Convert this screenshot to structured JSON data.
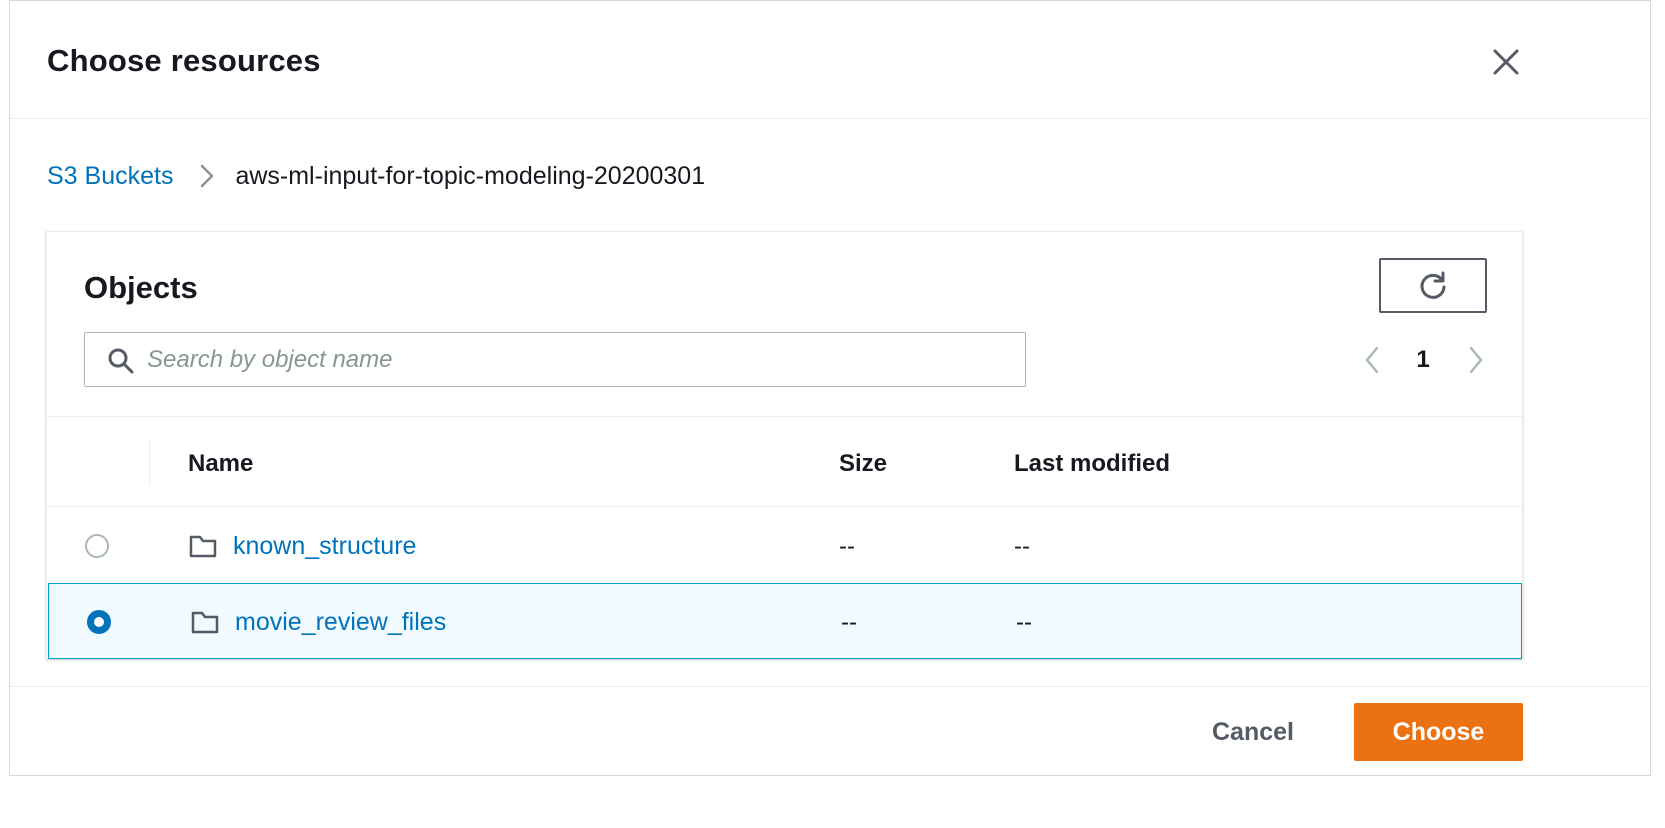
{
  "modal": {
    "title": "Choose resources",
    "close_icon": "close-icon"
  },
  "breadcrumb": {
    "items": [
      {
        "label": "S3 Buckets",
        "link": true
      },
      {
        "label": "aws-ml-input-for-topic-modeling-20200301",
        "link": false
      }
    ],
    "separator_icon": "chevron-right-icon"
  },
  "objects": {
    "title": "Objects",
    "refresh_icon": "refresh-icon",
    "search": {
      "placeholder": "Search by object name",
      "value": "",
      "icon": "search-icon"
    },
    "pagination": {
      "current_page": "1",
      "prev_icon": "chevron-left-icon",
      "next_icon": "chevron-right-icon"
    },
    "columns": [
      "Name",
      "Size",
      "Last modified"
    ],
    "rows": [
      {
        "name": "known_structure",
        "size": "--",
        "last_modified": "--",
        "selected": false,
        "icon": "folder-icon"
      },
      {
        "name": "movie_review_files",
        "size": "--",
        "last_modified": "--",
        "selected": true,
        "icon": "folder-icon"
      }
    ]
  },
  "footer": {
    "cancel_label": "Cancel",
    "choose_label": "Choose"
  },
  "colors": {
    "link": "#0073bb",
    "primary_button": "#ec7211",
    "selected_row_bg": "#f1faff",
    "selected_row_border": "#00a1c9",
    "text": "#16191f",
    "muted": "#879596"
  }
}
